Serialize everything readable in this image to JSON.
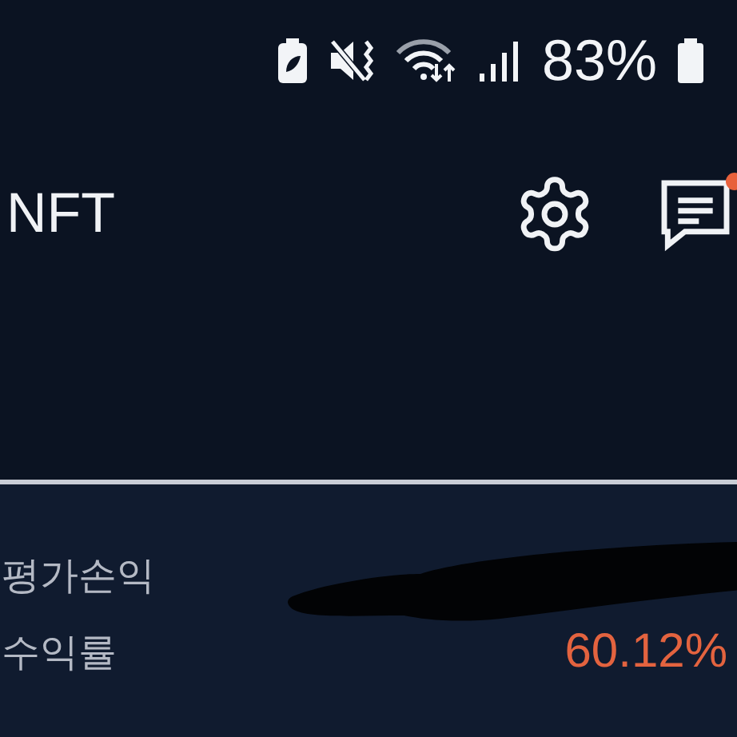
{
  "status_bar": {
    "battery_percent": "83%"
  },
  "header": {
    "title": "NFT",
    "notification_unread": true
  },
  "summary": {
    "rows": [
      {
        "label": "평가손익"
      },
      {
        "label": "수익률",
        "value": "60.12%"
      }
    ]
  }
}
